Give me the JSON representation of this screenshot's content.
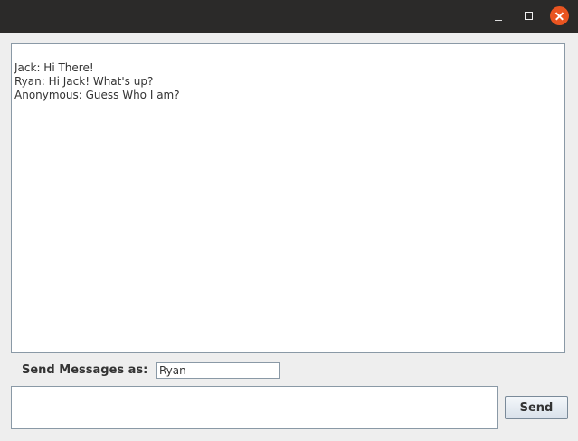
{
  "chat": {
    "messages": [
      "Jack: Hi There!",
      "Ryan: Hi Jack! What's up?",
      "Anonymous: Guess Who I am?"
    ]
  },
  "sender": {
    "label": "Send Messages as:",
    "value": "Ryan"
  },
  "composer": {
    "value": "",
    "send_label": "Send"
  },
  "window_controls": {
    "minimize_icon": "minimize-icon",
    "maximize_icon": "maximize-icon",
    "close_icon": "close-icon",
    "close_color": "#e95420"
  }
}
